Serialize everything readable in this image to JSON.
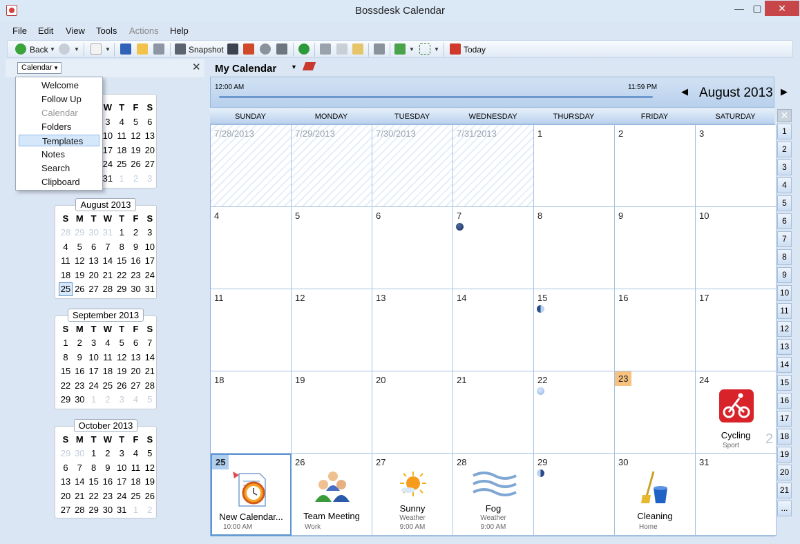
{
  "window": {
    "title": "Bossdesk Calendar",
    "min": "—",
    "max": "▢",
    "close": "✕"
  },
  "menu": [
    "File",
    "Edit",
    "View",
    "Tools",
    "Actions",
    "Help"
  ],
  "toolbar": {
    "back": "Back",
    "snapshot": "Snapshot",
    "today": "Today"
  },
  "sidebar": {
    "selector": "Calendar",
    "close": "✕",
    "popup": [
      "Welcome",
      "Follow Up",
      "Calendar",
      "Folders",
      "Templates",
      "Notes",
      "Search",
      "Clipboard"
    ],
    "popup_selected": "Templates",
    "popup_disabled": "Calendar",
    "weekdays": [
      "S",
      "M",
      "T",
      "W",
      "T",
      "F",
      "S"
    ],
    "partial_month": {
      "rows": [
        [
          "",
          "",
          "",
          "W",
          "T",
          "F",
          "S"
        ],
        [
          "",
          "",
          "",
          "3",
          "4",
          "5",
          "6"
        ],
        [
          "",
          "",
          "",
          "10",
          "11",
          "12",
          "13"
        ],
        [
          "",
          "",
          "",
          "17",
          "18",
          "19",
          "20"
        ],
        [
          "",
          "",
          "",
          "24",
          "25",
          "26",
          "27"
        ],
        [
          "",
          "",
          "",
          "31",
          "1",
          "2",
          "3"
        ]
      ]
    },
    "months": [
      {
        "title": "August 2013",
        "rows": [
          [
            "28",
            "29",
            "30",
            "31",
            "1",
            "2",
            "3"
          ],
          [
            "4",
            "5",
            "6",
            "7",
            "8",
            "9",
            "10"
          ],
          [
            "11",
            "12",
            "13",
            "14",
            "15",
            "16",
            "17"
          ],
          [
            "18",
            "19",
            "20",
            "21",
            "22",
            "23",
            "24"
          ],
          [
            "25",
            "26",
            "27",
            "28",
            "29",
            "30",
            "31"
          ]
        ]
      },
      {
        "title": "September 2013",
        "rows": [
          [
            "1",
            "2",
            "3",
            "4",
            "5",
            "6",
            "7"
          ],
          [
            "8",
            "9",
            "10",
            "11",
            "12",
            "13",
            "14"
          ],
          [
            "15",
            "16",
            "17",
            "18",
            "19",
            "20",
            "21"
          ],
          [
            "22",
            "23",
            "24",
            "25",
            "26",
            "27",
            "28"
          ],
          [
            "29",
            "30",
            "1",
            "2",
            "3",
            "4",
            "5"
          ]
        ]
      },
      {
        "title": "October 2013",
        "rows": [
          [
            "29",
            "30",
            "1",
            "2",
            "3",
            "4",
            "5"
          ],
          [
            "6",
            "7",
            "8",
            "9",
            "10",
            "11",
            "12"
          ],
          [
            "13",
            "14",
            "15",
            "16",
            "17",
            "18",
            "19"
          ],
          [
            "20",
            "21",
            "22",
            "23",
            "24",
            "25",
            "26"
          ],
          [
            "27",
            "28",
            "29",
            "30",
            "31",
            "1",
            "2"
          ]
        ]
      }
    ]
  },
  "calendar": {
    "name": "My Calendar",
    "time_start": "12:00 AM",
    "time_end": "11:59 PM",
    "month": "August 2013",
    "days": [
      "SUNDAY",
      "MONDAY",
      "TUESDAY",
      "WEDNESDAY",
      "THURSDAY",
      "FRIDAY",
      "SATURDAY"
    ],
    "weeks": [
      [
        "7/28/2013",
        "7/29/2013",
        "7/30/2013",
        "7/31/2013",
        "1",
        "2",
        "3"
      ],
      [
        "4",
        "5",
        "6",
        "7",
        "8",
        "9",
        "10"
      ],
      [
        "11",
        "12",
        "13",
        "14",
        "15",
        "16",
        "17"
      ],
      [
        "18",
        "19",
        "20",
        "21",
        "22",
        "23",
        "24"
      ],
      [
        "25",
        "26",
        "27",
        "28",
        "29",
        "30",
        "31"
      ]
    ],
    "events": {
      "cycling": {
        "title": "Cycling",
        "sub": "Sport",
        "count": "2"
      },
      "newcal": {
        "title": "New Calendar...",
        "time": "10:00 AM"
      },
      "meeting": {
        "title": "Team Meeting",
        "sub": "Work"
      },
      "sunny": {
        "title": "Sunny",
        "sub": "Weather",
        "time": "9:00 AM"
      },
      "fog": {
        "title": "Fog",
        "sub": "Weather",
        "time": "9:00 AM"
      },
      "cleaning": {
        "title": "Cleaning",
        "sub": "Home"
      }
    },
    "week_numbers": [
      "1",
      "2",
      "3",
      "4",
      "5",
      "6",
      "7",
      "8",
      "9",
      "10",
      "11",
      "12",
      "13",
      "14",
      "15",
      "16",
      "17",
      "18",
      "19",
      "20",
      "21",
      "..."
    ]
  },
  "colors": {
    "accent": "#5e95d2",
    "highlight": "#f7c27f",
    "close": "#c6464a"
  }
}
